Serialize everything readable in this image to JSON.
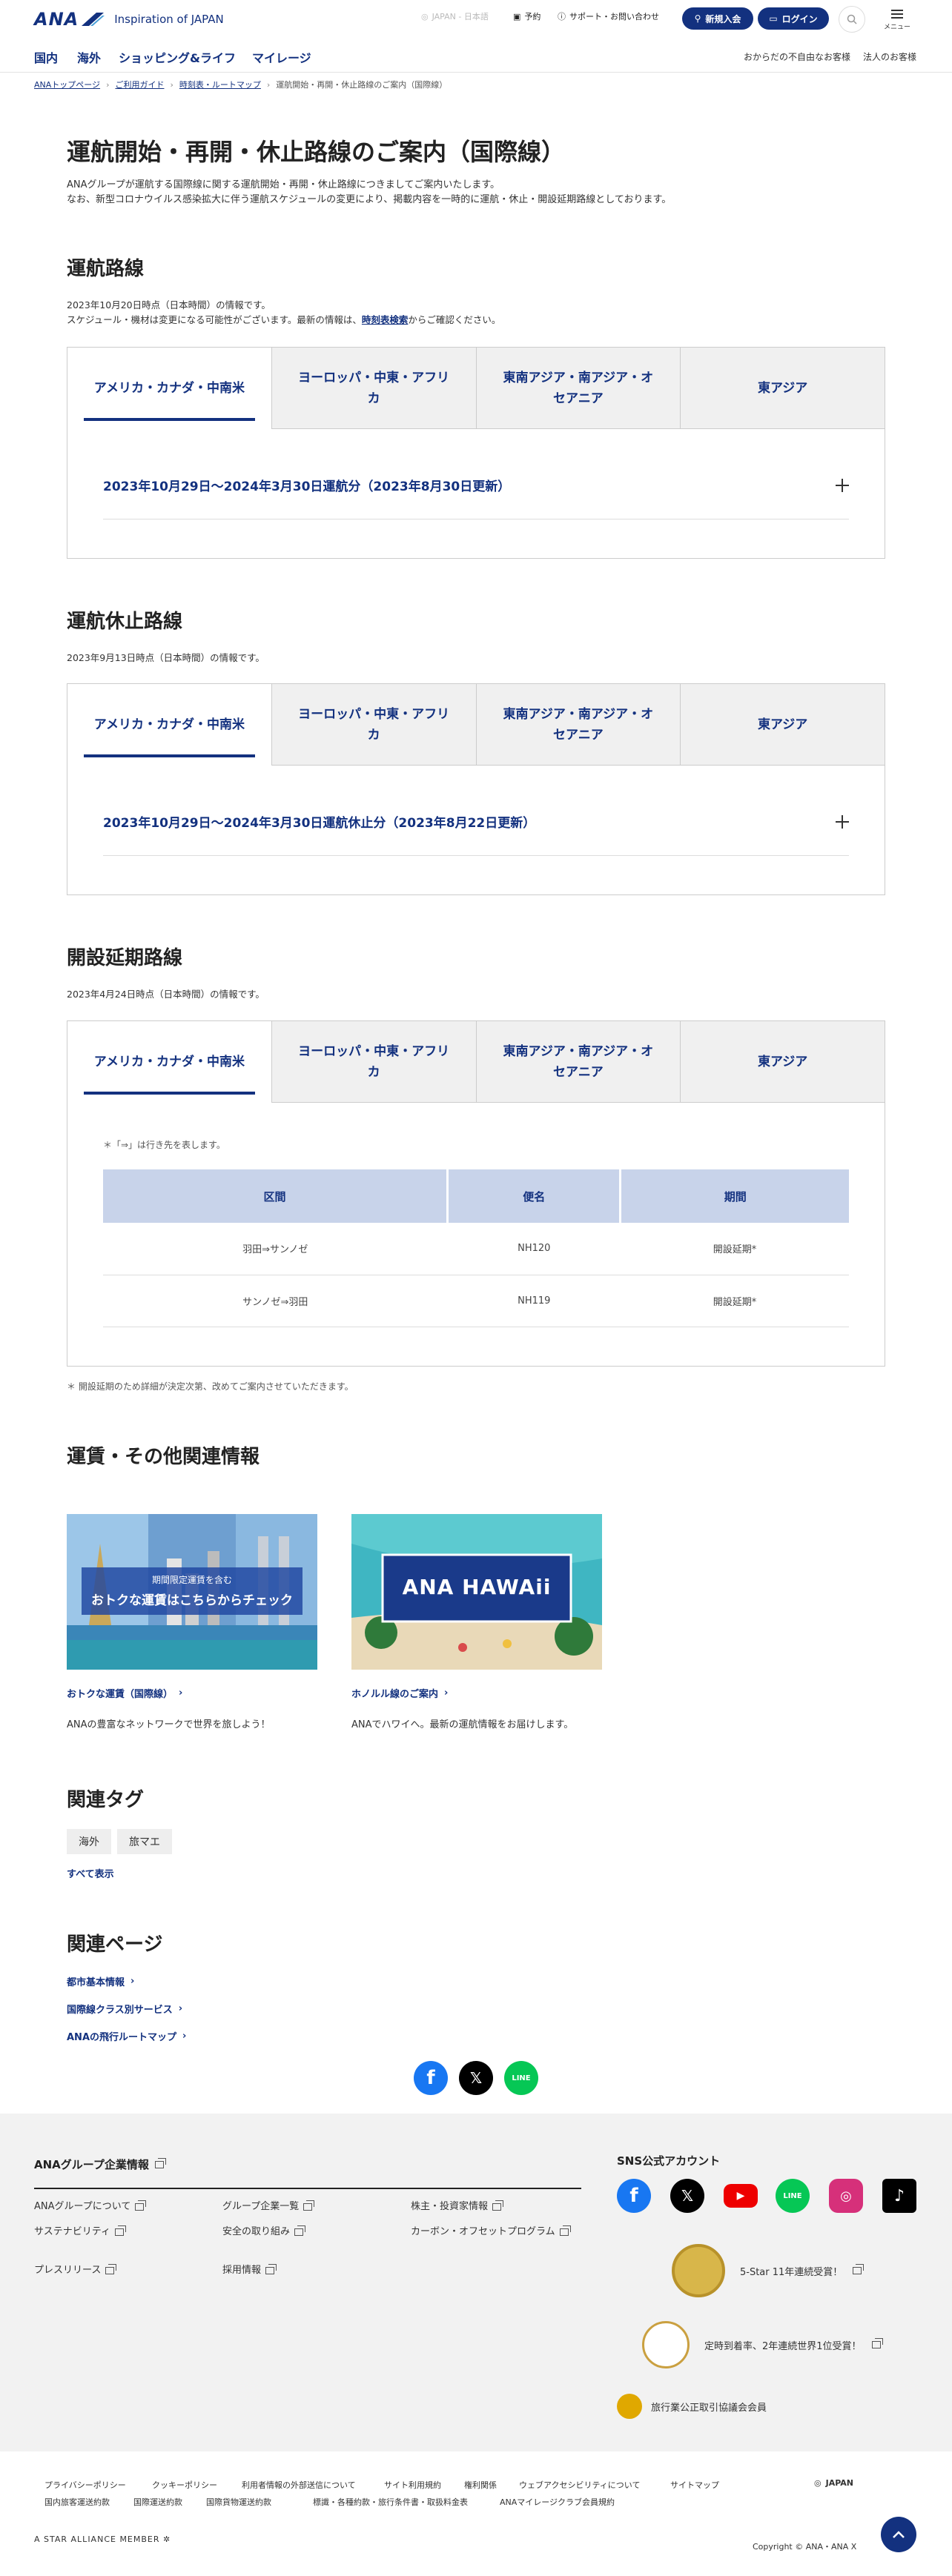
{
  "header": {
    "brand": "ANA",
    "tagline": "Inspiration of JAPAN",
    "language": "JAPAN - 日本語",
    "reserve": "予約",
    "support": "サポート・お問い合わせ",
    "join": "新規入会",
    "login": "ログイン",
    "menu": "メニュー"
  },
  "nav": {
    "items": [
      "国内",
      "海外",
      "ショッピング&ライフ",
      "マイレージ"
    ],
    "right": [
      "おからだの不自由なお客様",
      "法人のお客様"
    ]
  },
  "breadcrumb": [
    "ANAトップページ",
    "ご利用ガイド",
    "時刻表・ルートマップ",
    "運航開始・再開・休止路線のご案内（国際線）"
  ],
  "page": {
    "title": "運航開始・再開・休止路線のご案内（国際線）",
    "intro_1": "ANAグループが運航する国際線に関する運航開始・再開・休止路線につきましてご案内いたします。",
    "intro_2": "なお、新型コロナウイルス感染拡大に伴う運航スケジュールの変更により、掲載内容を一時的に運航・休止・開設延期路線としております。"
  },
  "tabs": [
    "アメリカ・カナダ・中南米",
    "ヨーロッパ・中東・アフリカ",
    "東南アジア・南アジア・オセアニア",
    "東アジア"
  ],
  "operating": {
    "title": "運航路線",
    "note_1": "2023年10月20日時点（日本時間）の情報です。",
    "note_2a": "スケジュール・機材は変更になる可能性がございます。最新の情報は、",
    "note_2_link": "時刻表検索",
    "note_2b": "からご確認ください。",
    "accordion": "2023年10月29日～2024年3月30日運航分（2023年8月30日更新）"
  },
  "suspended": {
    "title": "運航休止路線",
    "note": "2023年9月13日時点（日本時間）の情報です。",
    "accordion": "2023年10月29日～2024年3月30日運航休止分（2023年8月22日更新）"
  },
  "postponed": {
    "title": "開設延期路線",
    "note": "2023年4月24日時点（日本時間）の情報です。",
    "legend": "＊「⇒」は行き先を表します。",
    "columns": [
      "区間",
      "便名",
      "期間"
    ],
    "rows": [
      [
        "羽田⇒サンノゼ",
        "NH120",
        "開設延期*"
      ],
      [
        "サンノゼ⇒羽田",
        "NH119",
        "開設延期*"
      ]
    ],
    "footnote": "＊ 開設延期のため詳細が決定次第、改めてご案内させていただきます。"
  },
  "related_info": {
    "title": "運賃・その他関連情報",
    "cards": [
      {
        "banner_small": "期間限定運賃を含む",
        "banner_big": "おトクな運賃はこちらからチェック",
        "link": "おトクな運賃（国際線）",
        "desc": "ANAの豊富なネットワークで世界を旅しよう！"
      },
      {
        "banner_big": "ANA HAWAii",
        "link": "ホノルル線のご案内",
        "desc": "ANAでハワイへ。最新の運航情報をお届けします。"
      }
    ]
  },
  "tags": {
    "title": "関連タグ",
    "items": [
      "海外",
      "旅マエ"
    ],
    "show_all": "すべて表示"
  },
  "related_pages": {
    "title": "関連ページ",
    "links": [
      "都市基本情報",
      "国際線クラス別サービス",
      "ANAの飛行ルートマップ"
    ]
  },
  "footer": {
    "corp_title": "ANAグループ企業情報",
    "corp_links": [
      "ANAグループについて",
      "グループ企業一覧",
      "株主・投資家情報",
      "サステナビリティ",
      "安全の取り組み",
      "カーボン・オフセットプログラム",
      "プレスリリース",
      "採用情報"
    ],
    "sns_title": "SNS公式アカウント",
    "award_1": "5-Star 11年連続受賞！",
    "award_2": "定時到着率、2年連続世界1位受賞！",
    "award_3": "旅行業公正取引協議会会員",
    "bottom_links_1": [
      "プライバシーポリシー",
      "クッキーポリシー",
      "利用者情報の外部送信について",
      "サイト利用規約",
      "権利関係",
      "ウェブアクセシビリティについて",
      "サイトマップ"
    ],
    "bottom_links_2": [
      "国内旅客運送約款",
      "国際運送約款",
      "国際貨物運送約款",
      "標識・各種約款・旅行条件書・取扱料金表",
      "ANAマイレージクラブ会員規約"
    ],
    "region": "JAPAN",
    "alliance": "A STAR ALLIANCE MEMBER",
    "copyright": "Copyright © ANA・ANA X"
  },
  "colors": {
    "brand": "#13317f",
    "table_header": "#c8d3ea",
    "footer_bg": "#f2f2f2"
  }
}
